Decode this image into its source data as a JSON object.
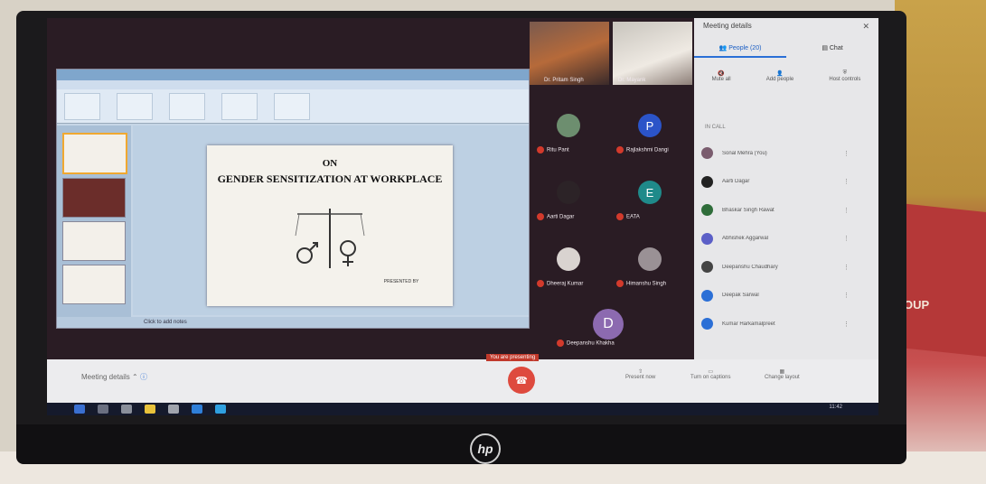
{
  "shared_slide": {
    "title_top": "ON",
    "title_main": "GENDER SENSITIZATION AT WORKPLACE",
    "presented_by": "PRESENTED BY",
    "status_bar": "Click to add notes"
  },
  "participant_tiles": [
    {
      "name": "Dr. Pritam Singh"
    },
    {
      "name": "Dr. Mayank"
    },
    {
      "name": "Ritu Pant",
      "initial": ""
    },
    {
      "name": "Rajlakshmi Dangi",
      "initial": "P",
      "color": "#2b54c8"
    },
    {
      "name": "Aarti Dagar",
      "initial": ""
    },
    {
      "name": "EATA",
      "initial": "E",
      "color": "#1f8a8a"
    },
    {
      "name": "Dheeraj Kumar",
      "initial": ""
    },
    {
      "name": "Himanshu Singh",
      "initial": ""
    },
    {
      "name": "Deepanshu Khakha",
      "initial": "D",
      "color": "#8c6ab0"
    }
  ],
  "panel": {
    "title": "Meeting details",
    "close_icon": "close-icon",
    "tab_people": "People (20)",
    "tab_chat": "Chat",
    "action_mute": "Mute all",
    "action_add": "Add people",
    "action_host": "Host controls",
    "section": "IN CALL",
    "participants": [
      {
        "name": "Sonal Mehra (You)",
        "color": "#7a5c6e"
      },
      {
        "name": "Aarti Dagar",
        "color": "#222222"
      },
      {
        "name": "Bhaskar Singh Rawat",
        "color": "#2f6d3a"
      },
      {
        "name": "Abhishek Aggarwal",
        "color": "#5b5fc7"
      },
      {
        "name": "Deepanshu Chaudhary",
        "color": "#444444"
      },
      {
        "name": "Deepak Sarwal",
        "color": "#2b6fd6"
      },
      {
        "name": "Kumar Harkamalpreet",
        "color": "#2b6fd6"
      }
    ]
  },
  "meet_bar": {
    "details_label": "Meeting details",
    "present_label": "You are presenting",
    "btn_present": "Present now",
    "btn_captions": "Turn on captions",
    "btn_layout": "Change layout"
  },
  "taskbar": {
    "clock": "11:42"
  }
}
